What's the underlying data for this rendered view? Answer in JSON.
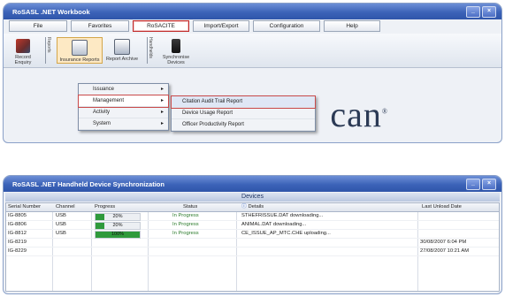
{
  "top_window": {
    "title": "RoSASL .NET Workbook",
    "menu": [
      "File",
      "Favorites",
      "RoSACITE",
      "Import/Export",
      "Configuration",
      "Help"
    ],
    "toolbar": {
      "group1_label": "Reports",
      "group2_label": "Handhelds",
      "buttons": [
        "Record Enquiry",
        "Insurance Reports",
        "Report Archive",
        "Synchronise Devices"
      ]
    },
    "dropdown": [
      "Issuance",
      "Management",
      "Activity",
      "System"
    ],
    "submenu": [
      "Citation Audit Trail Report",
      "Device Usage Report",
      "Officer Productivity Report"
    ],
    "logo_text": "can",
    "logo_mark": "®"
  },
  "bottom_window": {
    "title": "RoSASL .NET Handheld Device Synchronization",
    "panel_title": "Devices",
    "columns": [
      "Serial Number",
      "Channel",
      "Progress",
      "Status",
      "Details",
      "Last Unload Date"
    ],
    "rows": [
      {
        "serial": "IG-8805",
        "channel": "USB",
        "progress": 20,
        "progress_label": "20%",
        "status": "In Progress",
        "details": "STHEFRISSUE.DAT downloading...",
        "date": ""
      },
      {
        "serial": "IG-8806",
        "channel": "USB",
        "progress": 20,
        "progress_label": "20%",
        "status": "In Progress",
        "details": "ANIMAL.DAT downloading...",
        "date": ""
      },
      {
        "serial": "IG-8812",
        "channel": "USB",
        "progress": 100,
        "progress_label": "100%",
        "status": "In Progress",
        "details": "CE_ISSUE_AP_MTC.CHE uploading...",
        "date": ""
      },
      {
        "serial": "IG-8219",
        "channel": "",
        "progress": null,
        "progress_label": "",
        "status": "",
        "details": "",
        "date": "30/08/2007 6:04 PM"
      },
      {
        "serial": "IG-8229",
        "channel": "",
        "progress": null,
        "progress_label": "",
        "status": "",
        "details": "",
        "date": "27/08/2007 10:21 AM"
      }
    ]
  },
  "colors": {
    "titlebar": "#3c63b8",
    "progress": "#2f9a3c",
    "menu_highlight": "#c94a4a"
  }
}
